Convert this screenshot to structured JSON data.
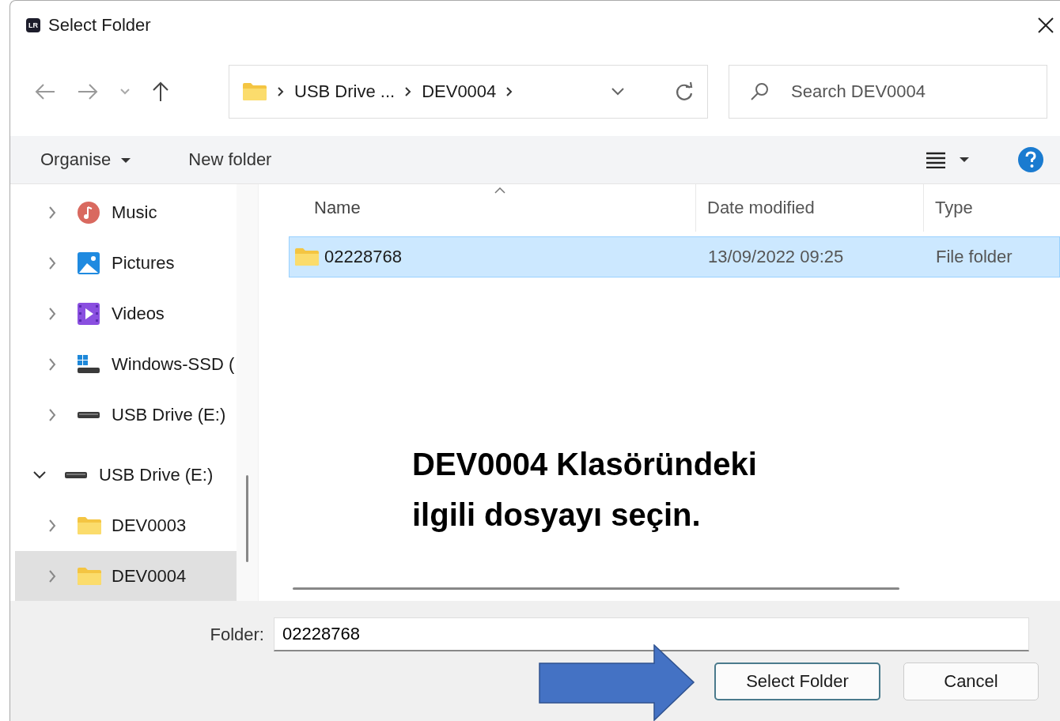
{
  "window": {
    "app_badge": "LR",
    "title": "Select Folder"
  },
  "address": {
    "segments": [
      "USB Drive ...",
      "DEV0004"
    ]
  },
  "search": {
    "placeholder": "Search DEV0004"
  },
  "toolbar": {
    "organise": "Organise",
    "new_folder": "New folder"
  },
  "sidebar": {
    "items": [
      {
        "children": [
          {
            "label": "Music",
            "kind": "music",
            "expanded": false,
            "selected": false
          },
          {
            "label": "Pictures",
            "kind": "pictures",
            "expanded": false,
            "selected": false
          },
          {
            "label": "Videos",
            "kind": "videos",
            "expanded": false,
            "selected": false
          },
          {
            "label": "Windows-SSD (",
            "kind": "ssd",
            "expanded": false,
            "selected": false
          },
          {
            "label": "USB Drive (E:)",
            "kind": "drive",
            "expanded": false,
            "selected": false
          }
        ]
      },
      {
        "label": "USB Drive (E:)",
        "kind": "drive",
        "expanded": true,
        "selected": false,
        "children": [
          {
            "label": "DEV0003",
            "kind": "folder",
            "expanded": false,
            "selected": false
          },
          {
            "label": "DEV0004",
            "kind": "folder",
            "expanded": false,
            "selected": true
          }
        ]
      }
    ]
  },
  "table": {
    "columns": [
      {
        "label": "Name",
        "sorted": true
      },
      {
        "label": "Date modified",
        "sorted": false
      },
      {
        "label": "Type",
        "sorted": false
      }
    ],
    "rows": [
      {
        "name": "02228768",
        "date": "13/09/2022 09:25",
        "type": "File folder",
        "selected": true
      }
    ]
  },
  "folder_field": {
    "label": "Folder:",
    "value": "02228768"
  },
  "buttons": [
    {
      "label": "Select Folder",
      "kind": "primary"
    },
    {
      "label": "Cancel",
      "kind": "secondary"
    }
  ],
  "annotation": {
    "text": "DEV0004 Klasöründeki\nilgili dosyayı seçin."
  }
}
